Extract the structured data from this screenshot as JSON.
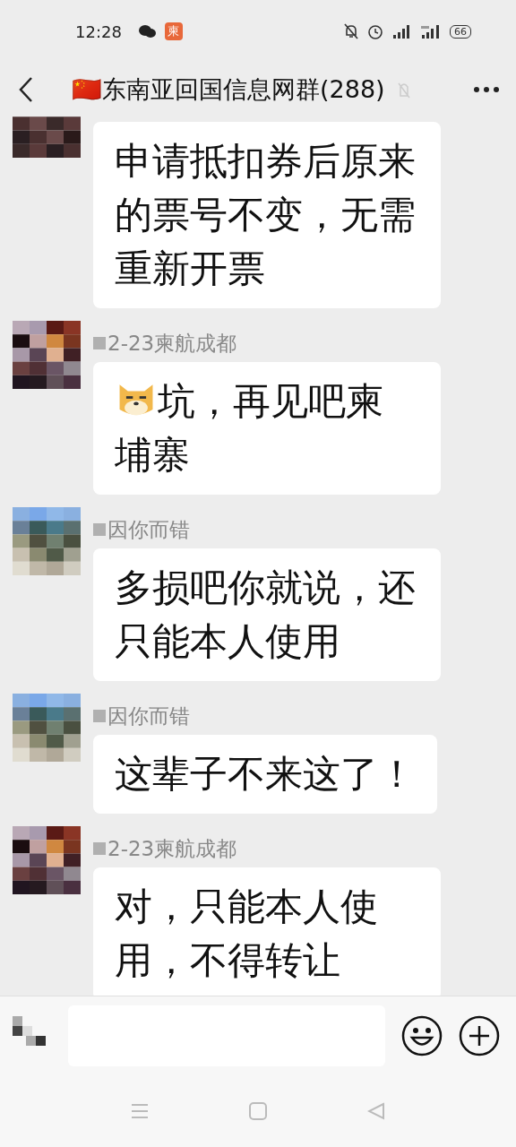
{
  "status_bar": {
    "time": "12:28",
    "app_badge": "柬",
    "battery": "66"
  },
  "header": {
    "flag": "🇨🇳",
    "title": "东南亚回国信息网群(288)"
  },
  "messages": [
    {
      "emoji": false,
      "text": "申请抵扣券后原来的票号不变，无需重新开票"
    },
    {
      "sender": "2-23柬航成都",
      "emoji": true,
      "text": "坑，再见吧柬埔寨"
    },
    {
      "sender": "因你而错",
      "emoji": false,
      "text": "多损吧你就说，还只能本人使用"
    },
    {
      "sender": "因你而错",
      "emoji": false,
      "text": "这辈子不来这了！"
    },
    {
      "sender": "2-23柬航成都",
      "emoji": false,
      "text": "对，只能本人使用，不得转让"
    }
  ]
}
